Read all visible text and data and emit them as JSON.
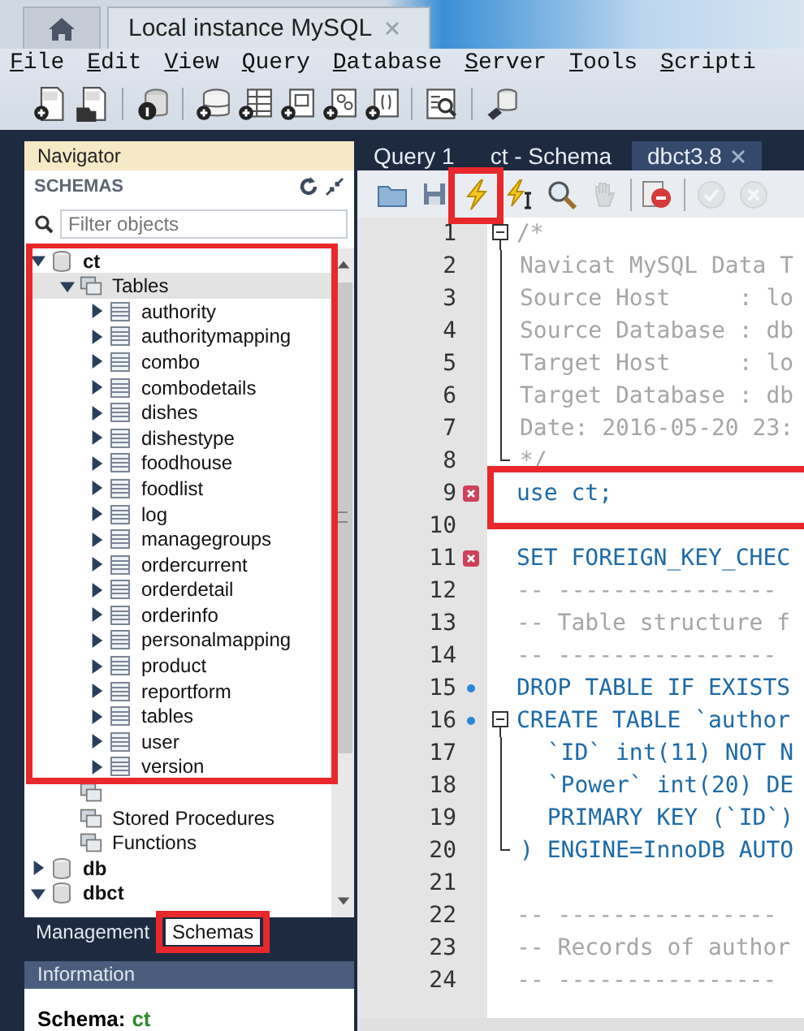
{
  "app_tabs": [
    {
      "kind": "home",
      "selected": false
    },
    {
      "kind": "connection",
      "label": "Local instance MySQL",
      "selected": true
    }
  ],
  "menu": [
    "File",
    "Edit",
    "View",
    "Query",
    "Database",
    "Server",
    "Tools",
    "Scripti"
  ],
  "toolbar": [
    [
      {
        "kind": "sql-new"
      },
      {
        "kind": "sql-open"
      }
    ],
    [
      {
        "kind": "info"
      }
    ],
    [
      {
        "kind": "schema-new"
      },
      {
        "kind": "table-new"
      },
      {
        "kind": "view-new"
      },
      {
        "kind": "procedure-new"
      },
      {
        "kind": "function-new"
      }
    ],
    [
      {
        "kind": "inspect"
      }
    ],
    [
      {
        "kind": "migration"
      }
    ]
  ],
  "navigator": {
    "title": "Navigator",
    "section": "SCHEMAS",
    "filter": {
      "placeholder": "Filter objects"
    },
    "schemas": [
      {
        "name": "ct",
        "expanded": true,
        "highlighted": true,
        "children": [
          {
            "label": "Tables",
            "expanded": true,
            "selected": true,
            "children": [
              {
                "label": "authority"
              },
              {
                "label": "authoritymapping"
              },
              {
                "label": "combo"
              },
              {
                "label": "combodetails"
              },
              {
                "label": "dishes"
              },
              {
                "label": "dishestype"
              },
              {
                "label": "foodhouse"
              },
              {
                "label": "foodlist"
              },
              {
                "label": "log"
              },
              {
                "label": "managegroups"
              },
              {
                "label": "ordercurrent"
              },
              {
                "label": "orderdetail"
              },
              {
                "label": "orderinfo"
              },
              {
                "label": "personalmapping"
              },
              {
                "label": "product"
              },
              {
                "label": "reportform"
              },
              {
                "label": "tables"
              },
              {
                "label": "user"
              },
              {
                "label": "version"
              }
            ]
          },
          {
            "kind": "folder"
          },
          {
            "label": "Stored Procedures",
            "selected": false
          },
          {
            "label": "Functions",
            "selected": false
          }
        ]
      },
      {
        "name": "db",
        "expanded": false
      },
      {
        "name": "dbct",
        "expanded": true
      }
    ],
    "tabs": [
      {
        "label": "Management",
        "selected": false
      },
      {
        "label": "Schemas",
        "selected": true,
        "highlighted": true
      }
    ]
  },
  "information": {
    "title": "Information",
    "label": "Schema:",
    "value": "ct"
  },
  "editor_tabs": [
    {
      "label": "Query 1",
      "selected": false,
      "closable": false
    },
    {
      "label": "ct - Schema",
      "selected": false,
      "closable": false
    },
    {
      "label": "dbct3.8",
      "selected": true,
      "closable": true
    }
  ],
  "editor_toolbar": [
    [
      {
        "kind": "open",
        "disabled": false
      },
      {
        "kind": "save",
        "disabled": false
      },
      {
        "kind": "execute",
        "disabled": false,
        "highlighted": true
      },
      {
        "kind": "execute-current",
        "disabled": false
      },
      {
        "kind": "explain",
        "disabled": false
      },
      {
        "kind": "stop",
        "disabled": true
      }
    ],
    [
      {
        "kind": "error-toggle",
        "disabled": false
      }
    ],
    [
      {
        "kind": "commit",
        "disabled": true
      },
      {
        "kind": "rollback",
        "disabled": true
      }
    ]
  ],
  "code_lines": [
    {
      "number": "1",
      "kind": "comment",
      "text": "/*",
      "fold": {
        "kind": "start"
      }
    },
    {
      "number": "2",
      "kind": "comment",
      "text": "Navicat MySQL Data T",
      "fold": {
        "kind": "line"
      }
    },
    {
      "number": "3",
      "kind": "comment",
      "text": "Source Host     : lo",
      "fold": {
        "kind": "line"
      }
    },
    {
      "number": "4",
      "kind": "comment",
      "text": "Source Database : db",
      "fold": {
        "kind": "line"
      }
    },
    {
      "number": "5",
      "kind": "comment",
      "text": "Target Host     : lo",
      "fold": {
        "kind": "line"
      }
    },
    {
      "number": "6",
      "kind": "comment",
      "text": "Target Database : db",
      "fold": {
        "kind": "line"
      }
    },
    {
      "number": "7",
      "kind": "comment",
      "text": "Date: 2016-05-20 23:",
      "fold": {
        "kind": "line"
      }
    },
    {
      "number": "8",
      "kind": "comment",
      "text": "*/",
      "fold": {
        "kind": "end"
      }
    },
    {
      "number": "9",
      "kind": "code",
      "text": "use ct;",
      "marker": {
        "kind": "error"
      },
      "highlighted": true
    },
    {
      "number": "10"
    },
    {
      "number": "11",
      "kind": "code",
      "text": "SET FOREIGN_KEY_CHEC",
      "marker": {
        "kind": "error"
      }
    },
    {
      "number": "12",
      "kind": "comment",
      "text": "-- ----------------"
    },
    {
      "number": "13",
      "kind": "comment",
      "text": "-- Table structure f"
    },
    {
      "number": "14",
      "kind": "comment",
      "text": "-- ----------------"
    },
    {
      "number": "15",
      "kind": "code",
      "text": "DROP TABLE IF EXISTS",
      "marker": {
        "kind": "statement"
      }
    },
    {
      "number": "16",
      "kind": "code",
      "text": "CREATE TABLE `author",
      "marker": {
        "kind": "statement"
      },
      "fold": {
        "kind": "start"
      }
    },
    {
      "number": "17",
      "kind": "code",
      "text": "  `ID` int(11) NOT N",
      "fold": {
        "kind": "line"
      }
    },
    {
      "number": "18",
      "kind": "code",
      "text": "  `Power` int(20) DE",
      "fold": {
        "kind": "line"
      }
    },
    {
      "number": "19",
      "kind": "code",
      "text": "  PRIMARY KEY (`ID`)",
      "fold": {
        "kind": "line"
      }
    },
    {
      "number": "20",
      "kind": "code",
      "text": ") ENGINE=InnoDB AUTO",
      "fold": {
        "kind": "end"
      }
    },
    {
      "number": "21"
    },
    {
      "number": "22",
      "kind": "comment",
      "text": "-- ----------------"
    },
    {
      "number": "23",
      "kind": "comment",
      "text": "-- Records of author"
    },
    {
      "number": "24",
      "kind": "comment",
      "text": "-- ----------------"
    }
  ]
}
